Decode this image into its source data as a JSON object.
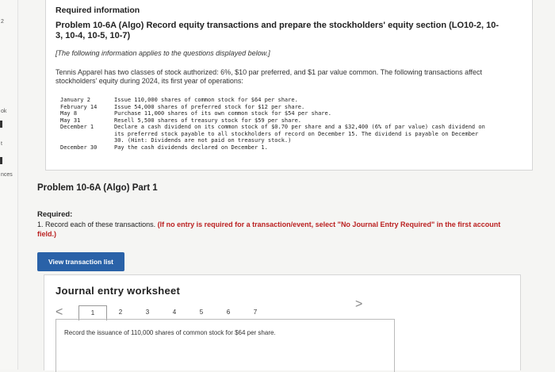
{
  "leftnav": {
    "items": [
      "2",
      "ok",
      "t",
      "nces"
    ]
  },
  "info": {
    "heading": "Required information",
    "problem_title": "Problem 10-6A (Algo) Record equity transactions and prepare the stockholders' equity section (LO10-2, 10-3, 10-4, 10-5, 10-7)",
    "note": "[The following information applies to the questions displayed below.]",
    "description": "Tennis Apparel has two classes of stock authorized: 6%, $10 par preferred, and $1 par value common. The following transactions affect stockholders' equity during 2024, its first year of operations:",
    "transactions": [
      {
        "date": "January 2",
        "text": "Issue 110,000 shares of common stock for $64 per share."
      },
      {
        "date": "February 14",
        "text": "Issue 54,000 shares of preferred stock for $12 per share."
      },
      {
        "date": "May 8",
        "text": "Purchase 11,000 shares of its own common stock for $54 per share."
      },
      {
        "date": "May 31",
        "text": "Resell 5,500 shares of treasury stock for $59 per share."
      },
      {
        "date": "December 1",
        "text": "Declare a cash dividend on its common stock of $0.70 per share and a $32,400 (6% of par value) cash dividend on its preferred stock payable to all stockholders of record on December 15. The dividend is payable on December 30. (Hint: Dividends are not paid on treasury stock.)"
      },
      {
        "date": "December 30",
        "text": "Pay the cash dividends declared on December 1."
      }
    ]
  },
  "part_title": "Problem 10-6A (Algo) Part 1",
  "required": {
    "label": "Required:",
    "text": "1. Record each of these transactions.",
    "note": "(If no entry is required for a transaction/event, select \"No Journal Entry Required\" in the first account field.)"
  },
  "view_button": "View transaction list",
  "worksheet": {
    "title": "Journal entry worksheet",
    "prev": "<",
    "next": ">",
    "tabs": [
      "1",
      "2",
      "3",
      "4",
      "5",
      "6",
      "7"
    ],
    "active_tab": "1",
    "content": "Record the issuance of 110,000 shares of common stock for $64 per share."
  }
}
